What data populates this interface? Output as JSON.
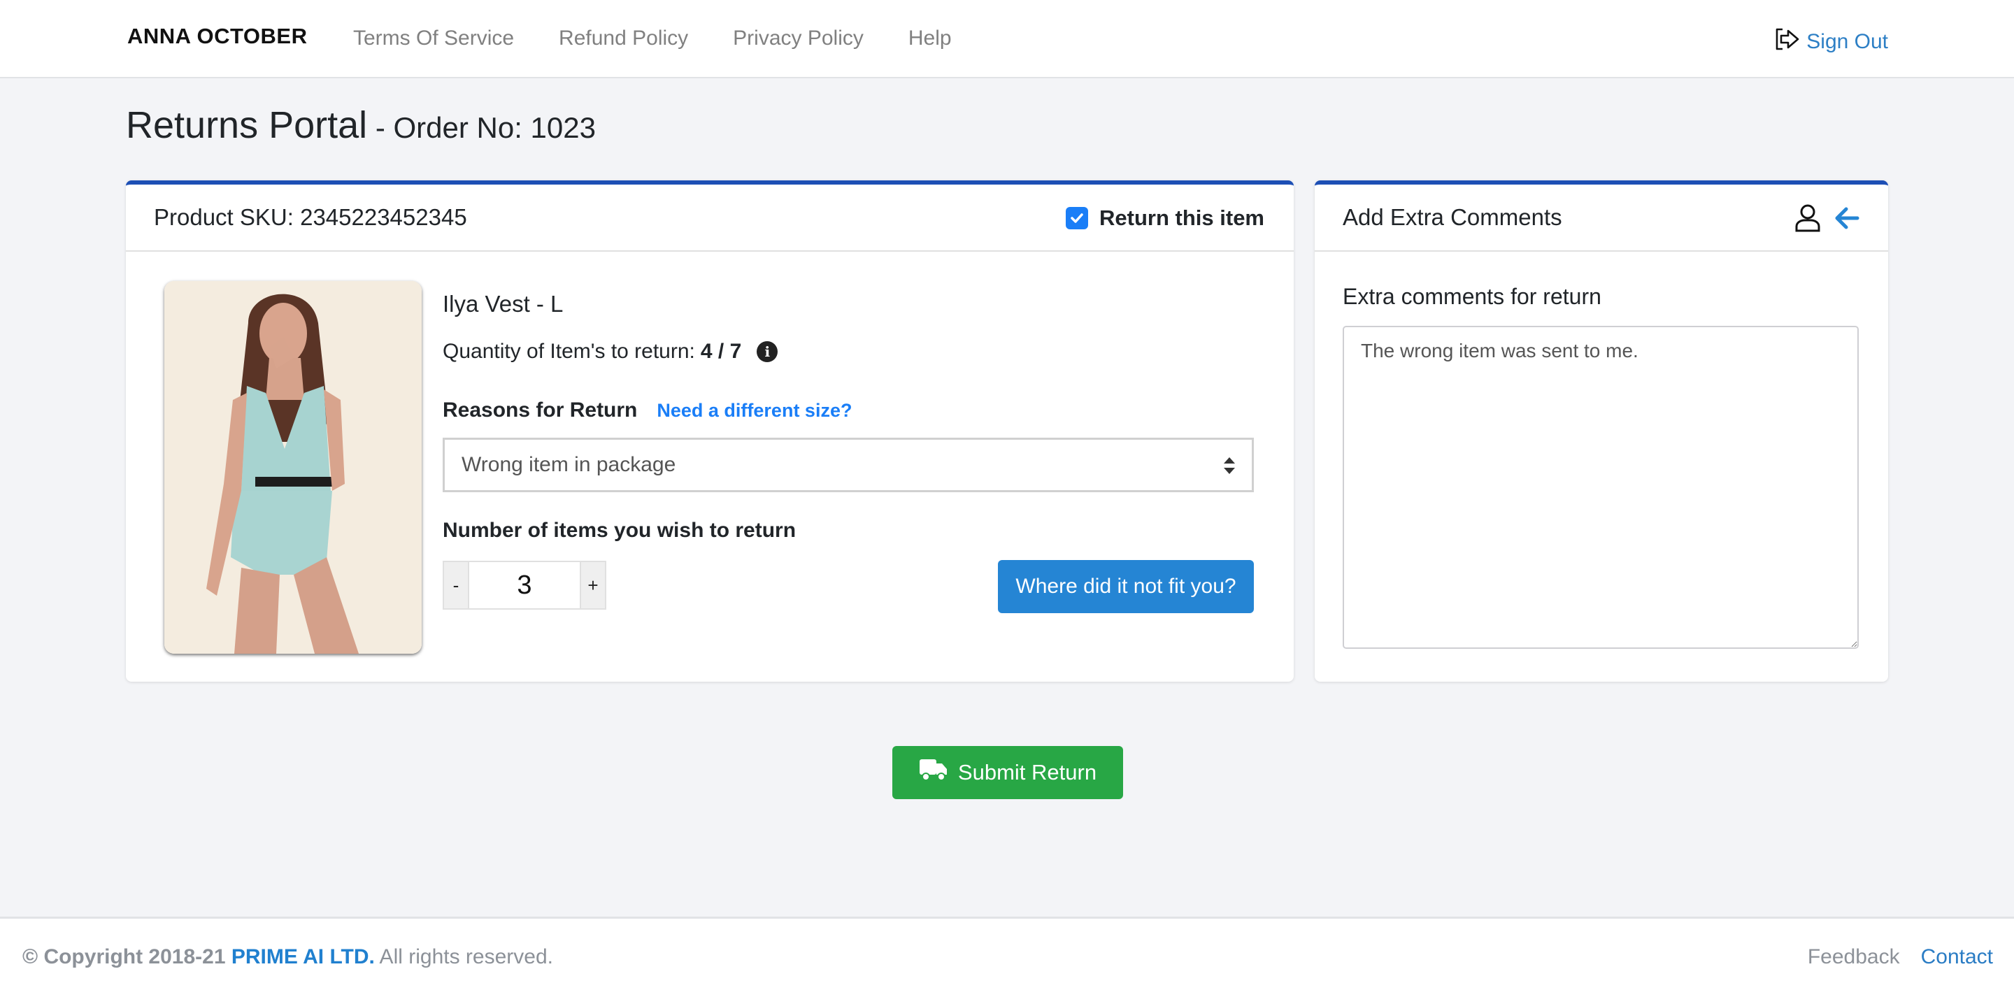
{
  "header": {
    "brand": "ANNA OCTOBER",
    "nav": [
      {
        "label": "Terms Of Service"
      },
      {
        "label": "Refund Policy"
      },
      {
        "label": "Privacy Policy"
      },
      {
        "label": "Help"
      }
    ],
    "sign_out_label": "Sign Out",
    "sign_out_icon": "sign-out-icon"
  },
  "page": {
    "title": "Returns Portal",
    "subtitle": " - Order No: 1023"
  },
  "product_card": {
    "sku_label": "Product SKU: 2345223452345",
    "return_checkbox_label": "Return this item",
    "return_checked": true,
    "product_name": "Ilya Vest - L",
    "quantity_label": "Quantity of Item's to return:",
    "quantity_value": "4 / 7",
    "info_icon": "info-circle-icon",
    "reasons_label": "Reasons for Return",
    "size_link": "Need a different size?",
    "reason_selected": "Wrong item in package",
    "number_label": "Number of items you wish to return",
    "stepper": {
      "minus": "-",
      "value": "3",
      "plus": "+"
    },
    "fit_button": "Where did it not fit you?"
  },
  "comments_card": {
    "title": "Add Extra Comments",
    "icons": [
      "user-icon",
      "arrow-left-icon"
    ],
    "label": "Extra comments for return",
    "value": "The wrong item was sent to me."
  },
  "submit_button": "Submit Return",
  "footer": {
    "copyright_prefix": "© Copyright 2018-21",
    "company": "PRIME AI LTD.",
    "rights": " All rights reserved.",
    "links": [
      {
        "label": "Feedback"
      },
      {
        "label": "Contact"
      }
    ]
  },
  "colors": {
    "accent_blue": "#2585d4",
    "card_top_border": "#1d4fb5",
    "submit_green": "#28a745",
    "link_blue": "#1a7ef7"
  }
}
